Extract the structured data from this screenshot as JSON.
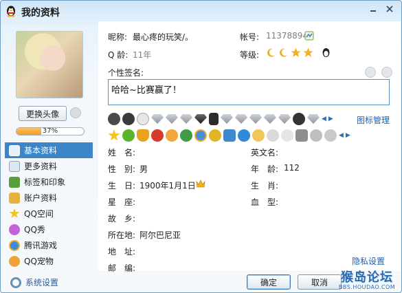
{
  "window": {
    "title": "我的资料"
  },
  "avatar": {
    "change_label": "更换头像"
  },
  "profile_progress": {
    "value": 0.37,
    "text": "37%"
  },
  "sidebar": {
    "items": [
      {
        "label": "基本资料",
        "icon": "profile-card-icon",
        "active": true
      },
      {
        "label": "更多资料",
        "icon": "more-info-icon"
      },
      {
        "label": "标签和印象",
        "icon": "tag-icon"
      },
      {
        "label": "账户资料",
        "icon": "account-icon"
      },
      {
        "label": "QQ空间",
        "icon": "star-icon"
      },
      {
        "label": "QQ秀",
        "icon": "qq-show-icon"
      },
      {
        "label": "腾讯游戏",
        "icon": "game-icon"
      },
      {
        "label": "QQ宠物",
        "icon": "pet-icon"
      }
    ]
  },
  "info": {
    "nickname_label": "昵称:",
    "nickname": "最心疼的玩笑/。",
    "account_label": "帐号:",
    "account": "11378894",
    "age_label": "Q 龄:",
    "age": "11年",
    "level_label": "等级:",
    "signature_label": "个性签名:",
    "signature": "哈哈~比赛赢了！"
  },
  "icon_manage_label": "图标管理",
  "details": {
    "name_label": "姓　名:",
    "name": "",
    "english_name_label": "英文名:",
    "english_name": "",
    "gender_label": "性　别:",
    "gender": "男",
    "years_label": "年　龄:",
    "years": "112",
    "birthday_label": "生　日:",
    "birthday": "1900年1月1日",
    "zodiac_label": "生　肖:",
    "zodiac": "",
    "constellation_label": "星　座:",
    "constellation": "",
    "blood_label": "血　型:",
    "blood": "",
    "hometown_label": "故　乡:",
    "hometown": "",
    "location_label": "所在地:",
    "location": "阿尔巴尼亚",
    "address_label": "地　址:",
    "address": "",
    "postcode_label": "邮　编:",
    "postcode": ""
  },
  "privacy_label": "隐私设置",
  "footer": {
    "settings_label": "系统设置",
    "ok_label": "确定",
    "cancel_label": "取消"
  },
  "watermark": {
    "main": "猴岛论坛",
    "sub": "BBS.HOUDAO.COM"
  },
  "colors": {
    "accent": "#3c85c8",
    "link": "#1e5fb4",
    "progress": "#f39a1e"
  }
}
